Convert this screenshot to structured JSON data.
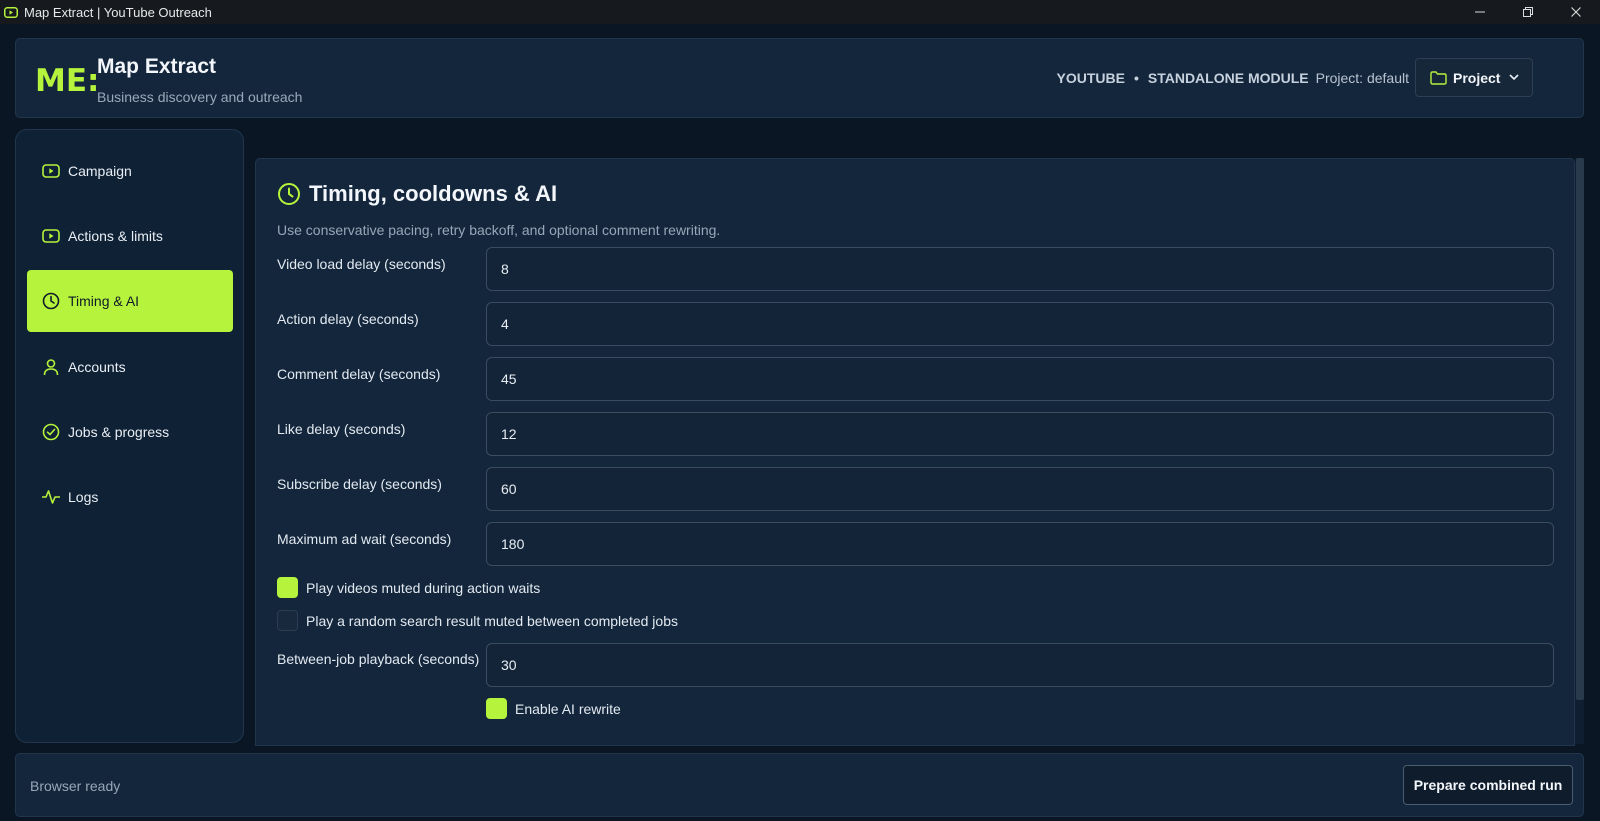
{
  "window": {
    "title": "Map Extract | YouTube Outreach",
    "icon": "youtube-icon"
  },
  "colors": {
    "accent": "#b6f33c",
    "background": "#0b1624",
    "panel": "#13263c",
    "sidebar": "#0f2135"
  },
  "header": {
    "logo": "ME:",
    "title": "Map Extract",
    "subtitle": "Business discovery and outreach",
    "platform": "YOUTUBE",
    "separator": "•",
    "module": "STANDALONE MODULE",
    "project_info": "Project: default",
    "project_button": "Project"
  },
  "sidebar": {
    "items": [
      {
        "label": "Campaign",
        "icon": "youtube-icon",
        "active": false
      },
      {
        "label": "Actions & limits",
        "icon": "youtube-icon",
        "active": false
      },
      {
        "label": "Timing & AI",
        "icon": "clock-icon",
        "active": true
      },
      {
        "label": "Accounts",
        "icon": "user-icon",
        "active": false
      },
      {
        "label": "Jobs & progress",
        "icon": "check-circle-icon",
        "active": false
      },
      {
        "label": "Logs",
        "icon": "activity-icon",
        "active": false
      }
    ]
  },
  "main": {
    "title": "Timing, cooldowns & AI",
    "description": "Use conservative pacing, retry backoff, and optional comment rewriting.",
    "fields": [
      {
        "label": "Video load delay (seconds)",
        "value": "8"
      },
      {
        "label": "Action delay (seconds)",
        "value": "4"
      },
      {
        "label": "Comment delay (seconds)",
        "value": "45"
      },
      {
        "label": "Like delay (seconds)",
        "value": "12"
      },
      {
        "label": "Subscribe delay (seconds)",
        "value": "60"
      },
      {
        "label": "Maximum ad wait (seconds)",
        "value": "180"
      }
    ],
    "checkboxes": [
      {
        "label": "Play videos muted during action waits",
        "checked": true
      },
      {
        "label": "Play a random search result muted between completed jobs",
        "checked": false
      }
    ],
    "between_job": {
      "label": "Between-job playback (seconds)",
      "value": "30"
    },
    "ai_rewrite": {
      "label": "Enable AI rewrite",
      "checked": true
    }
  },
  "footer": {
    "status": "Browser ready",
    "primary_button": "Prepare combined run"
  }
}
